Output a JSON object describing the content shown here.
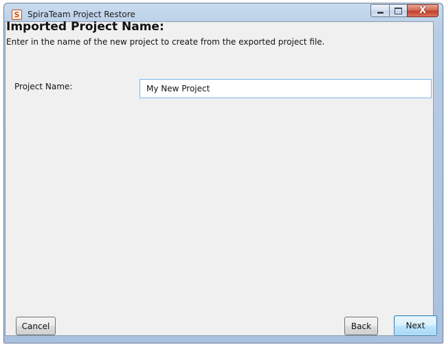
{
  "window": {
    "title": "SpiraTeam Project Restore",
    "icon_letter": "S",
    "controls": {
      "minimize": "minimize-icon",
      "maximize": "maximize-icon",
      "close": "X"
    }
  },
  "page": {
    "heading": "Imported Project Name:",
    "description": "Enter in the name of the new project to create from the exported project file."
  },
  "form": {
    "project_name_label": "Project Name:",
    "project_name_value": "My New Project"
  },
  "buttons": {
    "cancel": "Cancel",
    "back": "Back",
    "next": "Next"
  },
  "colors": {
    "titlebar": "#b7cde6",
    "client_bg": "#f0f0f0",
    "input_border": "#7eb4ea",
    "close_button": "#c0402d",
    "default_button_border": "#3c7fb1"
  }
}
